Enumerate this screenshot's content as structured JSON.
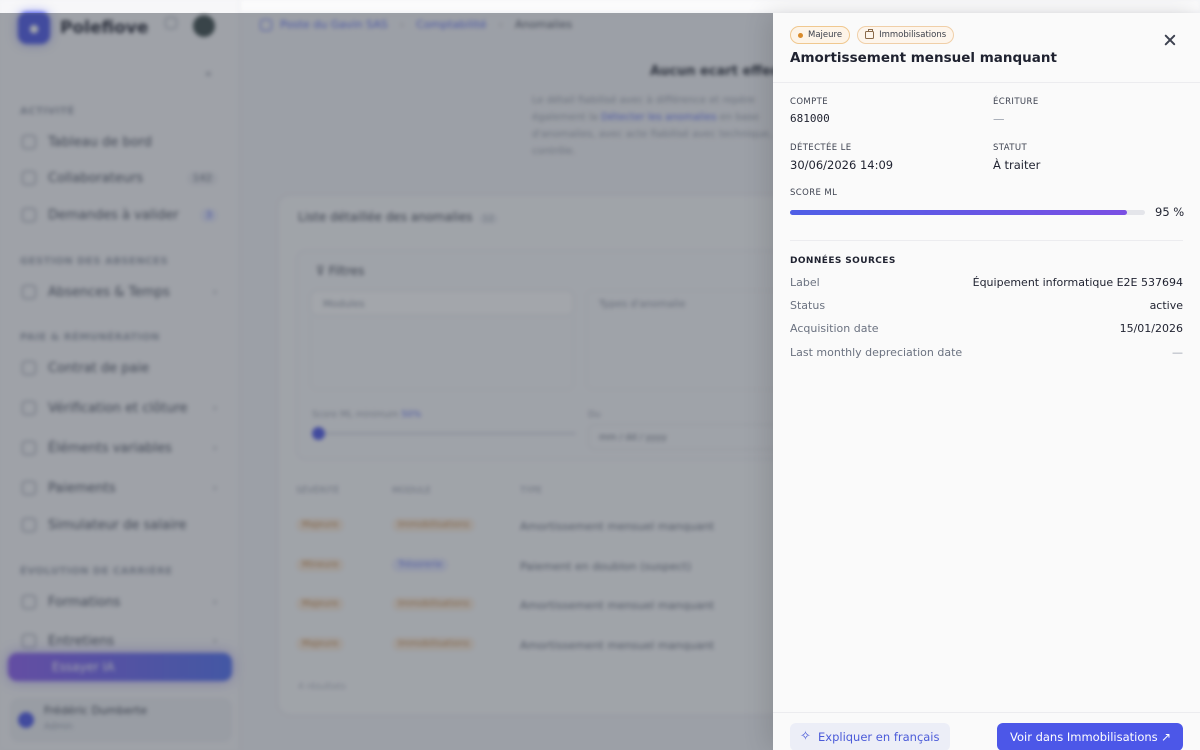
{
  "app": {
    "brand": "Polefiove",
    "breadcrumb": [
      "Poste du Gavin SAS",
      "Comptabilité",
      "Anomalies"
    ],
    "sidebar": {
      "sections": [
        {
          "title": "ACTIVITÉ",
          "items": [
            {
              "label": "Tableau de bord"
            },
            {
              "label": "Collaborateurs",
              "count": "142"
            },
            {
              "label": "Demandes à valider",
              "count": "3"
            }
          ]
        },
        {
          "title": "GESTION DES ABSENCES",
          "items": [
            {
              "label": "Absences & Temps"
            }
          ]
        },
        {
          "title": "PAIE & RÉMUNÉRATION",
          "items": [
            {
              "label": "Contrat de paie"
            },
            {
              "label": "Vérification et clôture"
            },
            {
              "label": "Éléments variables"
            },
            {
              "label": "Paiements"
            },
            {
              "label": "Simulateur de salaire"
            }
          ]
        },
        {
          "title": "ÉVOLUTION DE CARRIÈRE",
          "items": [
            {
              "label": "Formations"
            },
            {
              "label": "Entretiens"
            }
          ]
        }
      ],
      "promo": "Essayer IA",
      "user": {
        "name": "Frédéric Dumberte",
        "role": "Admin"
      }
    },
    "main": {
      "title": "Aucun ecart effectué",
      "subtitle_a": "Le détail fiabilisé avec à différence et repère également la",
      "subtitle_link": "Détecter les anomalies",
      "subtitle_b": "en base d'anomalies, avec acte fiabilisé avec technique, contrôle.",
      "card_title": "Liste détaillée des anomalies",
      "card_count": "12",
      "filters_label": "Filtres",
      "module_placeholder": "Modules",
      "type_placeholder": "Types d'anomalie",
      "score_label": "Score ML minimum",
      "score_value": "50%",
      "date_label": "Du",
      "date_value": "mm / dd / yyyy",
      "columns": [
        "SÉVÉRITÉ",
        "MODULE",
        "TYPE"
      ],
      "rows": [
        {
          "severity": "Majeure",
          "module": "Immobilisations",
          "type": "Amortissement mensuel manquant",
          "blue": false
        },
        {
          "severity": "Mineure",
          "module": "Trésorerie",
          "type": "Paiement en doublon (suspect)",
          "blue": true
        },
        {
          "severity": "Majeure",
          "module": "Immobilisations",
          "type": "Amortissement mensuel manquant",
          "blue": false
        },
        {
          "severity": "Majeure",
          "module": "Immobilisations",
          "type": "Amortissement mensuel manquant",
          "blue": false
        }
      ],
      "footer_note": "4 résultats"
    }
  },
  "panel": {
    "severity_badge": "Majeure",
    "module_badge": "Immobilisations",
    "title": "Amortissement mensuel manquant",
    "fields": {
      "compte_label": "Compte",
      "compte_value": "681000",
      "ecriture_label": "Écriture",
      "ecriture_value": "—",
      "detectee_label": "Détectée le",
      "detectee_value": "30/06/2026 14:09",
      "statut_label": "Statut",
      "statut_value": "À traiter",
      "score_label": "Score ML",
      "score_value": "95 %",
      "score_fraction": 0.95
    },
    "source_title": "Données sources",
    "source_rows": [
      {
        "key": "Label",
        "value": "Équipement informatique E2E 537694",
        "muted": false
      },
      {
        "key": "Status",
        "value": "active",
        "muted": false
      },
      {
        "key": "Acquisition date",
        "value": "15/01/2026",
        "muted": false
      },
      {
        "key": "Last monthly depreciation date",
        "value": "—",
        "muted": true
      }
    ],
    "explain_button": "Expliquer en français",
    "view_button": "Voir dans Immobilisations"
  },
  "icons": {
    "close": "close-icon",
    "explain": "sparkle-icon",
    "view": "arrow-up-right-icon",
    "module_badge": "briefcase-icon"
  },
  "colors": {
    "accent": "#4c57e8",
    "severity_major": "#d98b2b",
    "overlay": "rgba(55,60,72,0.46)"
  }
}
